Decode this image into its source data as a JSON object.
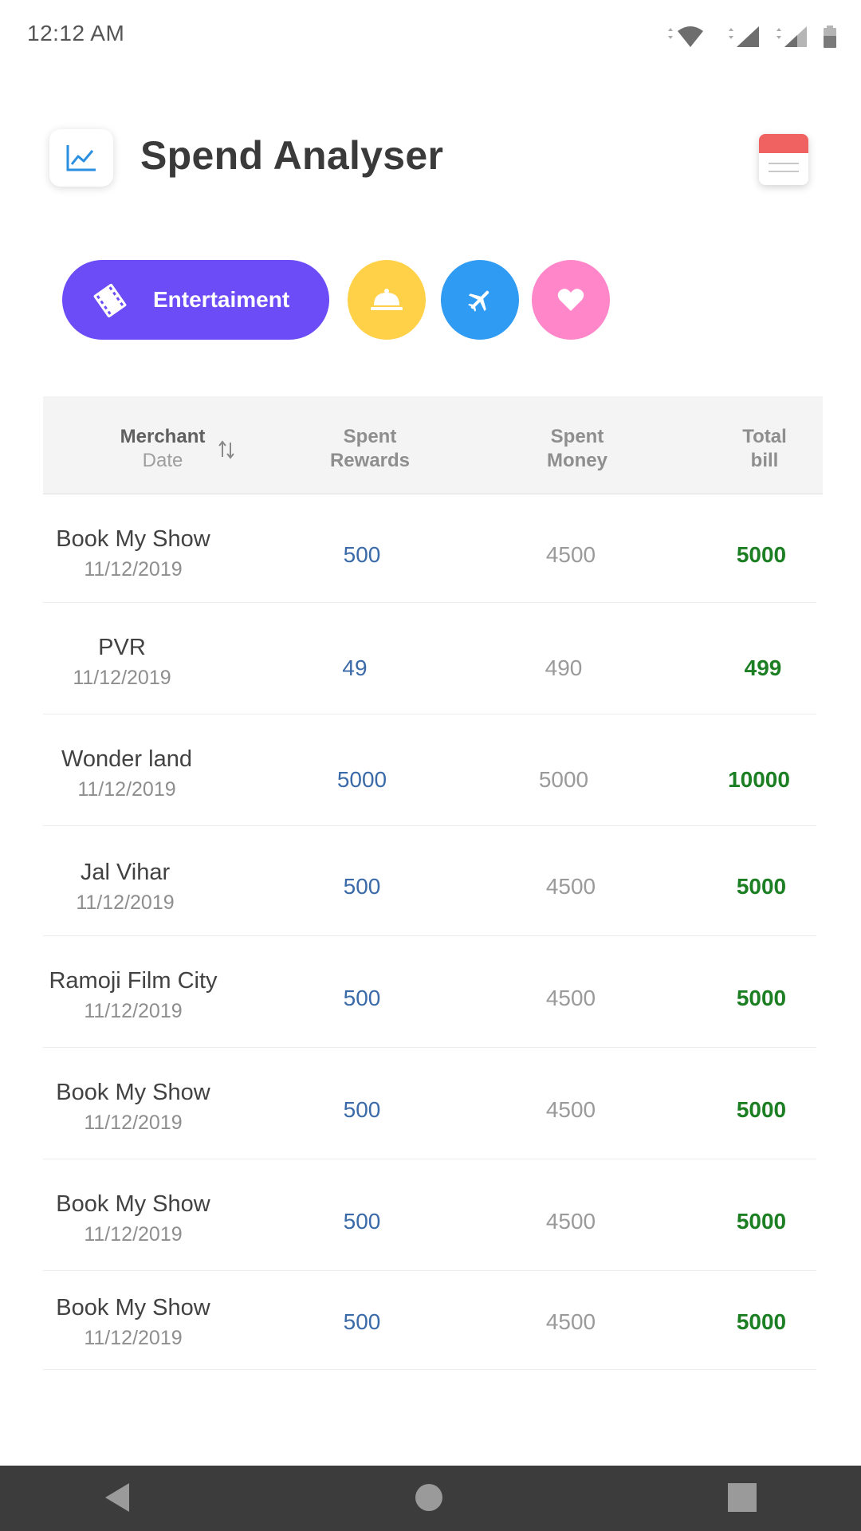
{
  "status_bar": {
    "time": "12:12 AM"
  },
  "header": {
    "title": "Spend Analyser"
  },
  "categories": {
    "active_label": "Entertaiment",
    "colors": {
      "active": "#6c4cf6",
      "food": "#ffd149",
      "travel": "#2f9bf2",
      "health": "#ff86c8"
    }
  },
  "table": {
    "headers": {
      "merchant": "Merchant",
      "date": "Date",
      "rewards_1": "Spent",
      "rewards_2": "Rewards",
      "money_1": "Spent",
      "money_2": "Money",
      "total_1": "Total",
      "total_2": "bill"
    },
    "rows": [
      {
        "merchant": "Book My Show",
        "date": "11/12/2019",
        "rewards": "500",
        "money": "4500",
        "total": "5000"
      },
      {
        "merchant": "PVR",
        "date": "11/12/2019",
        "rewards": "49",
        "money": "490",
        "total": "499"
      },
      {
        "merchant": "Wonder land",
        "date": "11/12/2019",
        "rewards": "5000",
        "money": "5000",
        "total": "10000"
      },
      {
        "merchant": "Jal Vihar",
        "date": "11/12/2019",
        "rewards": "500",
        "money": "4500",
        "total": "5000"
      },
      {
        "merchant": "Ramoji Film City",
        "date": "11/12/2019",
        "rewards": "500",
        "money": "4500",
        "total": "5000"
      },
      {
        "merchant": "Book My Show",
        "date": "11/12/2019",
        "rewards": "500",
        "money": "4500",
        "total": "5000"
      },
      {
        "merchant": "Book My Show",
        "date": "11/12/2019",
        "rewards": "500",
        "money": "4500",
        "total": "5000"
      },
      {
        "merchant": "Book My Show",
        "date": "11/12/2019",
        "rewards": "500",
        "money": "4500",
        "total": "5000"
      }
    ]
  }
}
